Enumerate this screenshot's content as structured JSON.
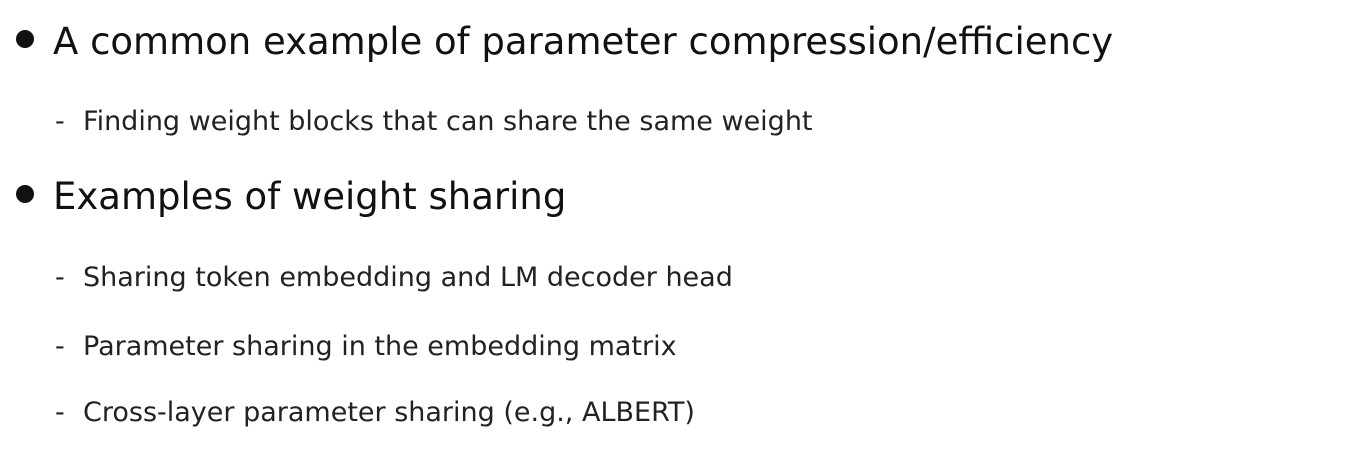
{
  "bullets": [
    {
      "text": "A common example of parameter compression/efficiency",
      "subitems": [
        {
          "text": "Finding weight blocks that can share the same weight"
        }
      ]
    },
    {
      "text": "Examples of weight sharing",
      "subitems": [
        {
          "text": "Sharing token embedding and LM decoder head"
        },
        {
          "text": "Parameter sharing in the embedding matrix"
        },
        {
          "text": "Cross-layer parameter sharing (e.g., ALBERT)"
        }
      ]
    }
  ],
  "dash_glyph": "-"
}
